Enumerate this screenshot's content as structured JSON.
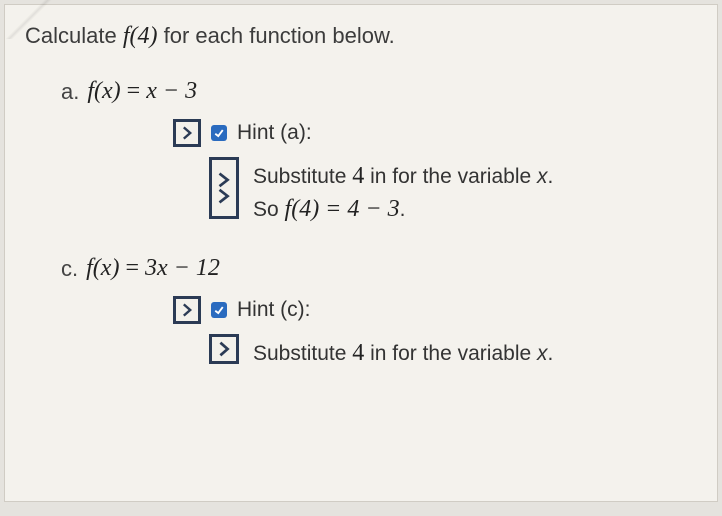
{
  "prompt": {
    "pre": "Calculate ",
    "fn": "f(4)",
    "post": " for each function below."
  },
  "items": [
    {
      "letter": "a.",
      "formula_lhs": "f(x)",
      "formula_rhs": "x − 3",
      "hint_label": "Hint (a):",
      "hint_lines": {
        "line1_pre": "Substitute ",
        "line1_num": "4",
        "line1_mid": " in for the variable ",
        "line1_var": "x",
        "line1_post": ".",
        "line2_pre": "So ",
        "line2_formula": "f(4) = 4 − 3",
        "line2_post": "."
      }
    },
    {
      "letter": "c.",
      "formula_lhs": "f(x)",
      "formula_rhs": "3x − 12",
      "hint_label": "Hint (c):",
      "hint_lines": {
        "line1_pre": "Substitute ",
        "line1_num": "4",
        "line1_mid": " in for the variable ",
        "line1_var": "x",
        "line1_post": "."
      }
    }
  ]
}
